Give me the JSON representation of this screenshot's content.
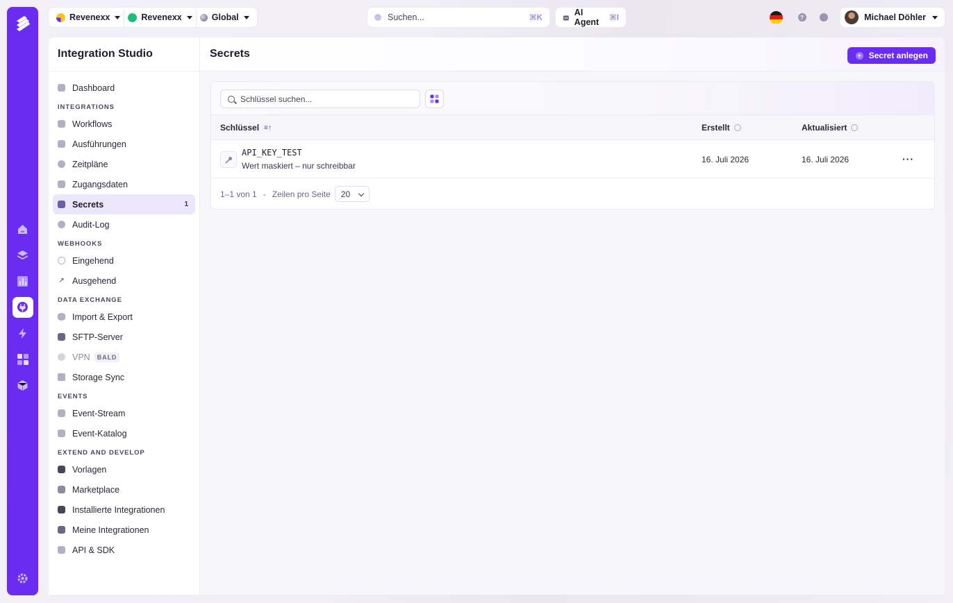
{
  "topbar": {
    "org_selector": "Revenexx",
    "workspace_selector": "Revenexx",
    "region_selector": "Global",
    "search_placeholder": "Suchen...",
    "search_shortcut": "⌘K",
    "ai_agent_label": "AI Agent",
    "ai_agent_shortcut": "⌘I",
    "user_name": "Michael Döhler"
  },
  "sidebar": {
    "title": "Integration Studio",
    "items": {
      "dashboard": "Dashboard",
      "integrations_section": "INTEGRATIONS",
      "workflows": "Workflows",
      "ausfuehrungen": "Ausführungen",
      "zeitplaene": "Zeitpläne",
      "zugangsdaten": "Zugangsdaten",
      "secrets": "Secrets",
      "secrets_count": "1",
      "audit_log": "Audit-Log",
      "webhooks_section": "WEBHOOKS",
      "eingehend": "Eingehend",
      "ausgehend": "Ausgehend",
      "data_exchange_section": "DATA EXCHANGE",
      "import_export": "Import & Export",
      "sftp_server": "SFTP-Server",
      "vpn": "VPN",
      "vpn_badge": "BALD",
      "storage_sync": "Storage Sync",
      "events_section": "EVENTS",
      "event_stream": "Event-Stream",
      "event_katalog": "Event-Katalog",
      "extend_section": "EXTEND AND DEVELOP",
      "vorlagen": "Vorlagen",
      "marketplace": "Marketplace",
      "installierte_integrationen": "Installierte Integrationen",
      "meine_integrationen": "Meine Integrationen",
      "api_sdk": "API & SDK"
    }
  },
  "main": {
    "page_title": "Secrets",
    "create_button": "Secret anlegen",
    "search_placeholder": "Schlüssel suchen...",
    "table": {
      "columns": {
        "key": "Schlüssel",
        "created": "Erstellt",
        "updated": "Aktualisiert"
      },
      "rows": [
        {
          "key": "API_KEY_TEST",
          "subtitle": "Wert maskiert – nur schreibbar",
          "created": "16. Juli 2026",
          "updated": "16. Juli 2026"
        }
      ]
    },
    "pagination": {
      "range": "1–1 von 1",
      "separator": "-",
      "rows_per_page_label": "Zeilen pro Seite",
      "rows_per_page_value": "20"
    }
  },
  "colors": {
    "accent": "#6a2cf0",
    "active_nav_bg": "#ece6fb",
    "workspace_dot": "#1fbf7a"
  }
}
